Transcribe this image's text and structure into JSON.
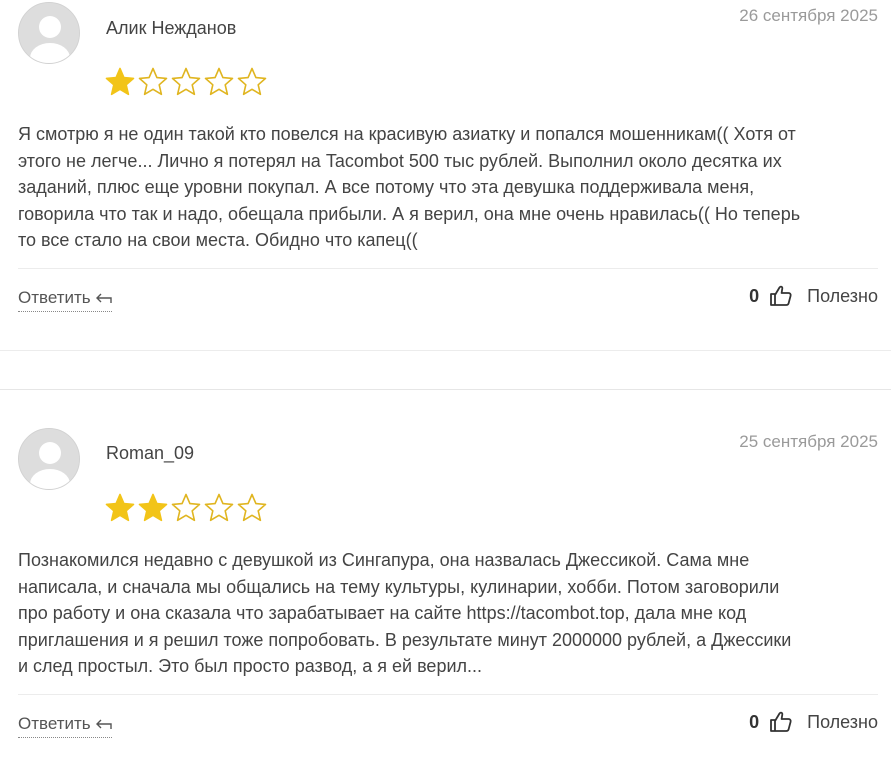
{
  "reviews": [
    {
      "author": "Алик Нежданов",
      "date": "26 сентября 2025",
      "rating": 1,
      "rating_max": 5,
      "text_lines": [
        "Я смотрю я не один такой кто повелся на красивую азиатку и попался мошенникам(( Хотя от",
        "этого не легче... Лично я потерял на Tacombot 500 тыс рублей. Выполнил около десятка их",
        "заданий, плюс еще уровни покупал. А все потому что эта девушка поддерживала меня,",
        "говорила что так и надо, обещала прибыли. А я верил, она мне очень нравилась(( Но теперь",
        "то все стало на свои места. Обидно что капец(("
      ],
      "reply_label": "Ответить",
      "useful_count": "0",
      "useful_label": "Полезно"
    },
    {
      "author": "Roman_09",
      "date": "25 сентября 2025",
      "rating": 2,
      "rating_max": 5,
      "text_lines": [
        "Познакомился недавно с девушкой из Сингапура, она назвалась Джессикой. Сама мне",
        "написала, и сначала мы общались на тему культуры, кулинарии, хобби. Потом заговорили",
        "про работу и она сказала что зарабатывает на сайте https://tacombot.top, дала мне код",
        "приглашения и я решил тоже попробовать. В результате минут 2000000 рублей, а Джессики",
        "и след простыл. Это был просто развод, а я ей верил..."
      ],
      "reply_label": "Ответить",
      "useful_count": "0",
      "useful_label": "Полезно"
    }
  ],
  "colors": {
    "star_filled": "#f2c418",
    "star_empty_stroke": "#e0b520",
    "date": "#9a9a9a"
  },
  "icons": {
    "avatar": "default-user-avatar",
    "reply": "reply-arrow-icon",
    "like": "thumbs-up-icon"
  }
}
